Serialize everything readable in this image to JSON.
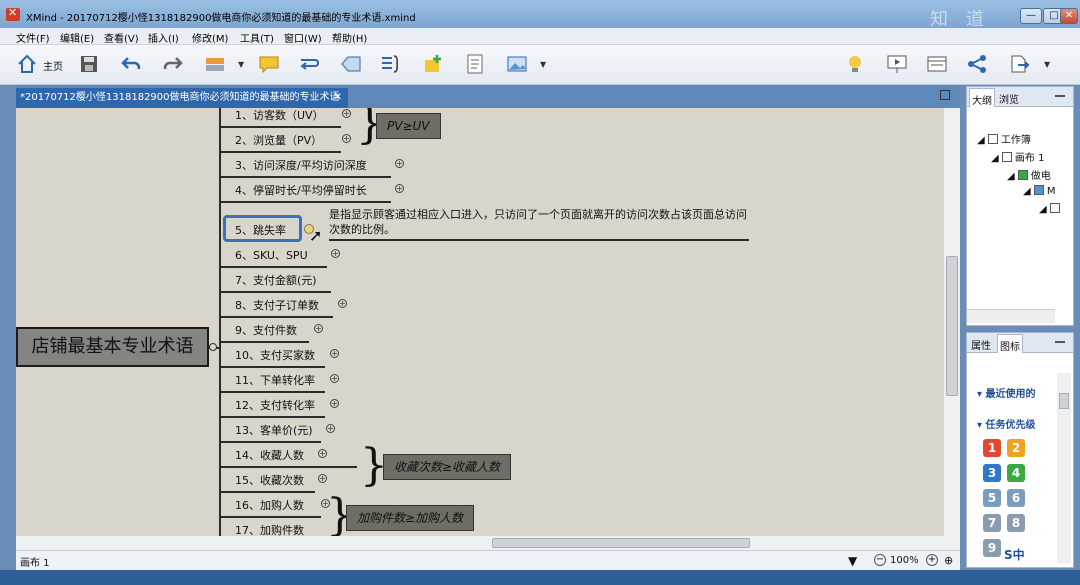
{
  "window": {
    "title": "XMind - 20170712樱小怪1318182900做电商你必须知道的最基础的专业术语.xmind",
    "watermark": "知 道"
  },
  "menu": [
    "文件(F)",
    "编辑(E)",
    "查看(V)",
    "插入(I)",
    "修改(M)",
    "工具(T)",
    "窗口(W)",
    "帮助(H)"
  ],
  "toolbar": {
    "home_label": "主页",
    "icons": [
      "home-icon",
      "save-icon",
      "undo-icon",
      "redo-icon",
      "insert-topic-icon",
      "callout-icon",
      "relationship-icon",
      "boundary-icon",
      "summary-icon",
      "note-icon",
      "task-icon",
      "image-icon",
      "idea-icon",
      "presentation-icon",
      "layout-icon",
      "share-icon",
      "export-icon"
    ]
  },
  "editor": {
    "tab_title": "*20170712樱小怪1318182900做电商你必须知道的最基础的专业术语"
  },
  "map": {
    "central_topic": "店铺最基本专业术语",
    "topics": [
      {
        "label": "1、访客数（UV）"
      },
      {
        "label": "2、浏览量（PV）"
      },
      {
        "label": "3、访问深度/平均访问深度"
      },
      {
        "label": "4、停留时长/平均停留时长"
      },
      {
        "label": "5、跳失率"
      },
      {
        "label": "6、SKU、SPU"
      },
      {
        "label": "7、支付金额(元)"
      },
      {
        "label": "8、支付子订单数"
      },
      {
        "label": "9、支付件数"
      },
      {
        "label": "10、支付买家数"
      },
      {
        "label": "11、下单转化率"
      },
      {
        "label": "12、支付转化率"
      },
      {
        "label": "13、客单价(元)"
      },
      {
        "label": "14、收藏人数"
      },
      {
        "label": "15、收藏次数"
      },
      {
        "label": "16、加购人数"
      },
      {
        "label": "17、加购件数"
      }
    ],
    "summaries": [
      "PV≥UV",
      "收藏次数≥收藏人数",
      "加购件数≥加购人数"
    ],
    "note": "是指显示顾客通过相应入口进入，只访问了一个页面就离开的访问次数占该页面总访问次数的比例。"
  },
  "status": {
    "sheet_tab": "画布 1",
    "zoom": "100%"
  },
  "outline_panel": {
    "tabs": [
      "大纲",
      "浏览"
    ],
    "tree": [
      "工作簿",
      "画布 1",
      "做电",
      "M",
      ""
    ]
  },
  "props_panel": {
    "tabs": [
      "属性",
      "图标"
    ],
    "recent_label": "最近使用的",
    "priority_label": "任务优先级",
    "priorities": [
      {
        "n": "1",
        "color": "#e0482f"
      },
      {
        "n": "2",
        "color": "#f0a321"
      },
      {
        "n": "3",
        "color": "#2f77c9"
      },
      {
        "n": "4",
        "color": "#3aa845"
      },
      {
        "n": "5",
        "color": "#7a9cc0"
      },
      {
        "n": "6",
        "color": "#7a9cc0"
      },
      {
        "n": "7",
        "color": "#8a9caf"
      },
      {
        "n": "8",
        "color": "#8a9caf"
      },
      {
        "n": "9",
        "color": "#8a9caf"
      }
    ]
  },
  "ime": "S中"
}
